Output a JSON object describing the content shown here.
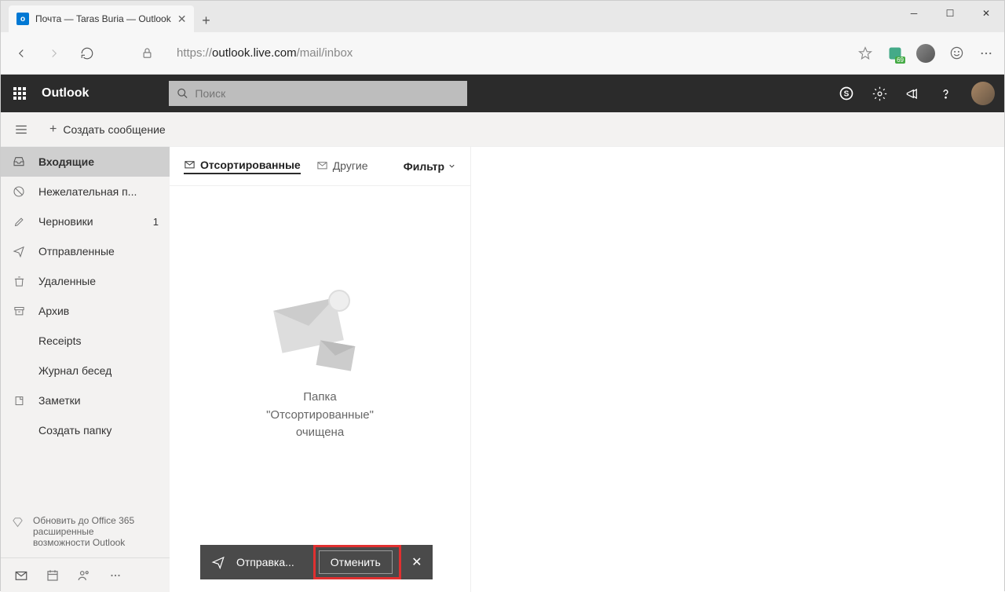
{
  "browser": {
    "tab_title": "Почта — Taras Buria — Outlook",
    "url_proto": "https://",
    "url_host": "outlook.live.com",
    "url_path": "/mail/inbox",
    "ext_badge": "69"
  },
  "header": {
    "brand": "Outlook",
    "search_placeholder": "Поиск"
  },
  "subbar": {
    "new_message": "Создать сообщение"
  },
  "sidebar": {
    "folders": [
      {
        "label": "Входящие",
        "icon": "inbox",
        "active": true
      },
      {
        "label": "Нежелательная п...",
        "icon": "block"
      },
      {
        "label": "Черновики",
        "icon": "pencil",
        "count": "1"
      },
      {
        "label": "Отправленные",
        "icon": "send"
      },
      {
        "label": "Удаленные",
        "icon": "trash"
      },
      {
        "label": "Архив",
        "icon": "archive"
      },
      {
        "label": "Receipts",
        "icon": ""
      },
      {
        "label": "Журнал бесед",
        "icon": ""
      },
      {
        "label": "Заметки",
        "icon": "note"
      },
      {
        "label": "Создать папку",
        "icon": ""
      }
    ],
    "upgrade": "Обновить до Office 365 расширенные возможности Outlook"
  },
  "pivot": {
    "focused": "Отсортированные",
    "other": "Другие",
    "filter": "Фильтр"
  },
  "empty": {
    "line1": "Папка",
    "line2": "\"Отсортированные\"",
    "line3": "очищена"
  },
  "toast": {
    "sending": "Отправка...",
    "undo": "Отменить"
  }
}
